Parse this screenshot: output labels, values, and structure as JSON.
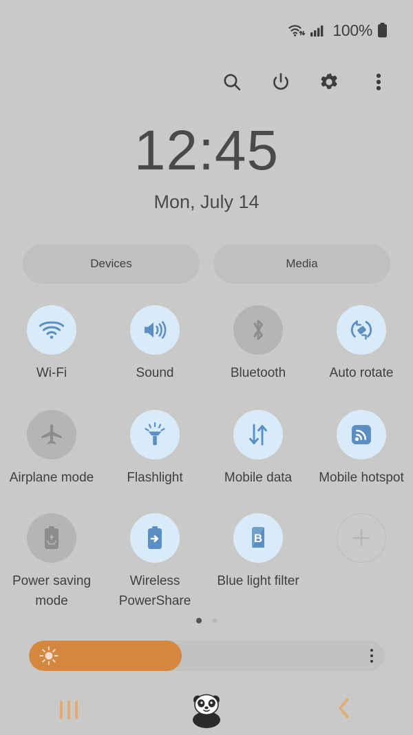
{
  "status_bar": {
    "wifi_icon": "wifi-data-icon",
    "signal_icon": "cellular-signal-icon",
    "battery_percent": "100%",
    "battery_icon": "battery-full-icon"
  },
  "action_row": {
    "items": [
      {
        "name": "search-icon",
        "label": "Search"
      },
      {
        "name": "power-icon",
        "label": "Power"
      },
      {
        "name": "settings-icon",
        "label": "Settings"
      },
      {
        "name": "more-options-icon",
        "label": "More options"
      }
    ]
  },
  "clock": {
    "time": "12:45",
    "date": "Mon, July 14"
  },
  "pills": [
    {
      "label": "Devices"
    },
    {
      "label": "Media"
    }
  ],
  "toggles": {
    "row1": [
      {
        "label": "Wi-Fi",
        "icon": "wifi-icon",
        "state": "on"
      },
      {
        "label": "Sound",
        "icon": "sound-icon",
        "state": "on"
      },
      {
        "label": "Bluetooth",
        "icon": "bluetooth-icon",
        "state": "off"
      },
      {
        "label": "Auto rotate",
        "icon": "auto-rotate-icon",
        "state": "on"
      }
    ],
    "row2": [
      {
        "label": "Airplane mode",
        "icon": "airplane-icon",
        "state": "off"
      },
      {
        "label": "Flashlight",
        "icon": "flashlight-icon",
        "state": "on"
      },
      {
        "label": "Mobile data",
        "icon": "mobile-data-icon",
        "state": "on"
      },
      {
        "label": "Mobile hotspot",
        "icon": "mobile-hotspot-icon",
        "state": "on"
      }
    ],
    "row3": [
      {
        "label": "Power saving mode",
        "icon": "power-saving-icon",
        "state": "off"
      },
      {
        "label": "Wireless PowerShare",
        "icon": "wireless-powershare-icon",
        "state": "on"
      },
      {
        "label": "Blue light filter",
        "icon": "blue-light-filter-icon",
        "state": "on"
      },
      {
        "label": "",
        "icon": "add-button-icon",
        "state": "add"
      }
    ]
  },
  "page_dots": {
    "total": 2,
    "active_index": 0
  },
  "brightness": {
    "icon": "brightness-sun-icon",
    "fill_percent": 43,
    "menu_icon": "brightness-options-icon"
  },
  "nav_bar": {
    "recents": "recents-icon",
    "home": "panda-home-icon",
    "back": "back-icon"
  },
  "colors": {
    "background": "#c9c9c7",
    "toggle_on_bg": "#d9eaf8",
    "toggle_off_bg": "#b5b5b3",
    "toggle_icon_blue": "#5b8fc4",
    "accent_orange": "#d4883f",
    "nav_accent": "#e4ab74",
    "text": "#3f3f3f"
  }
}
